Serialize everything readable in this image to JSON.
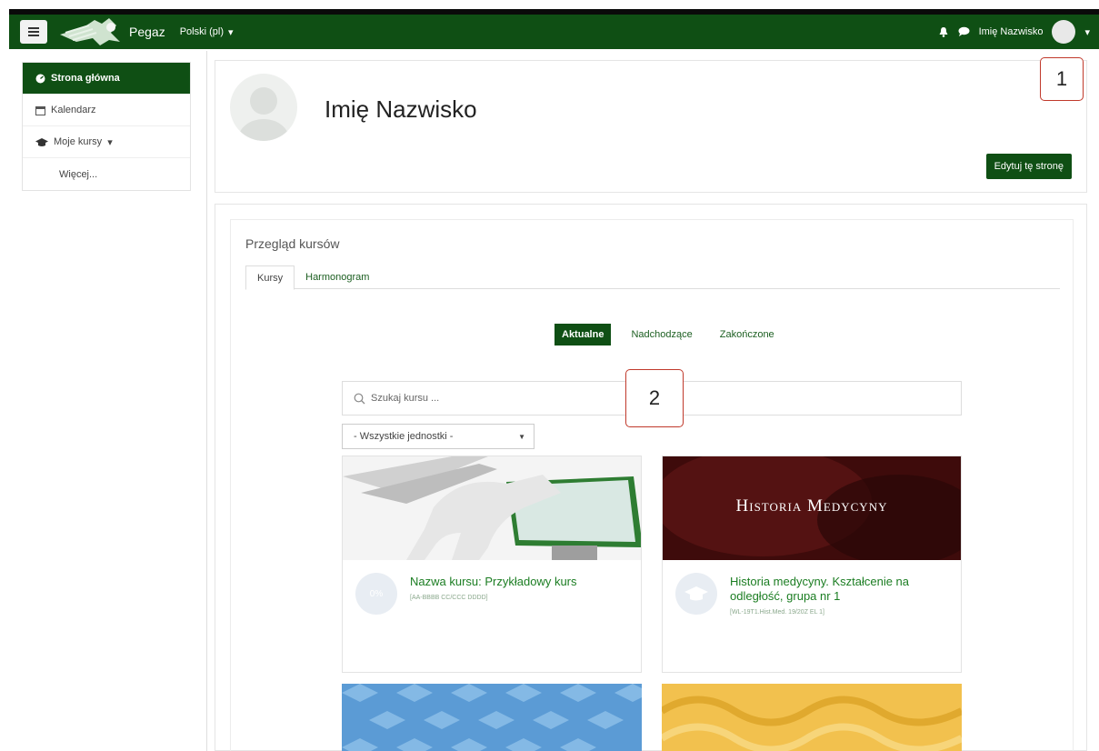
{
  "navbar": {
    "brand": "Pegaz",
    "language": "Polski (pl)",
    "user_name": "Imię Nazwisko"
  },
  "sidebar": {
    "items": [
      {
        "label": "Strona główna",
        "icon": "dashboard-icon"
      },
      {
        "label": "Kalendarz",
        "icon": "calendar-icon"
      },
      {
        "label": "Moje kursy",
        "icon": "graduation-cap-icon"
      },
      {
        "label": "Więcej..."
      }
    ]
  },
  "profile": {
    "name": "Imię Nazwisko",
    "edit_button": "Edytuj tę stronę"
  },
  "callouts": {
    "one": "1",
    "two": "2"
  },
  "overview": {
    "title": "Przegląd kursów",
    "tabs": [
      "Kursy",
      "Harmonogram"
    ],
    "filters": [
      "Aktualne",
      "Nadchodzące",
      "Zakończone"
    ],
    "search_placeholder": "Szukaj kursu ...",
    "unit_select": "- Wszystkie jednostki -"
  },
  "courses": [
    {
      "name": "Nazwa kursu: Przykładowy kurs",
      "code": "[AA-BBBB CC/CCC DDDD]",
      "progress": "0%"
    },
    {
      "name": "Historia medycyny. Kształcenie na odległość, grupa nr 1",
      "code": "[WL-19T1.Hist.Med. 19/20Z EL 1]",
      "banner": "Historia Medycyny"
    }
  ],
  "colors": {
    "primary": "#0f4f14",
    "link": "#1b7d22",
    "callout_border": "#c0392b"
  }
}
